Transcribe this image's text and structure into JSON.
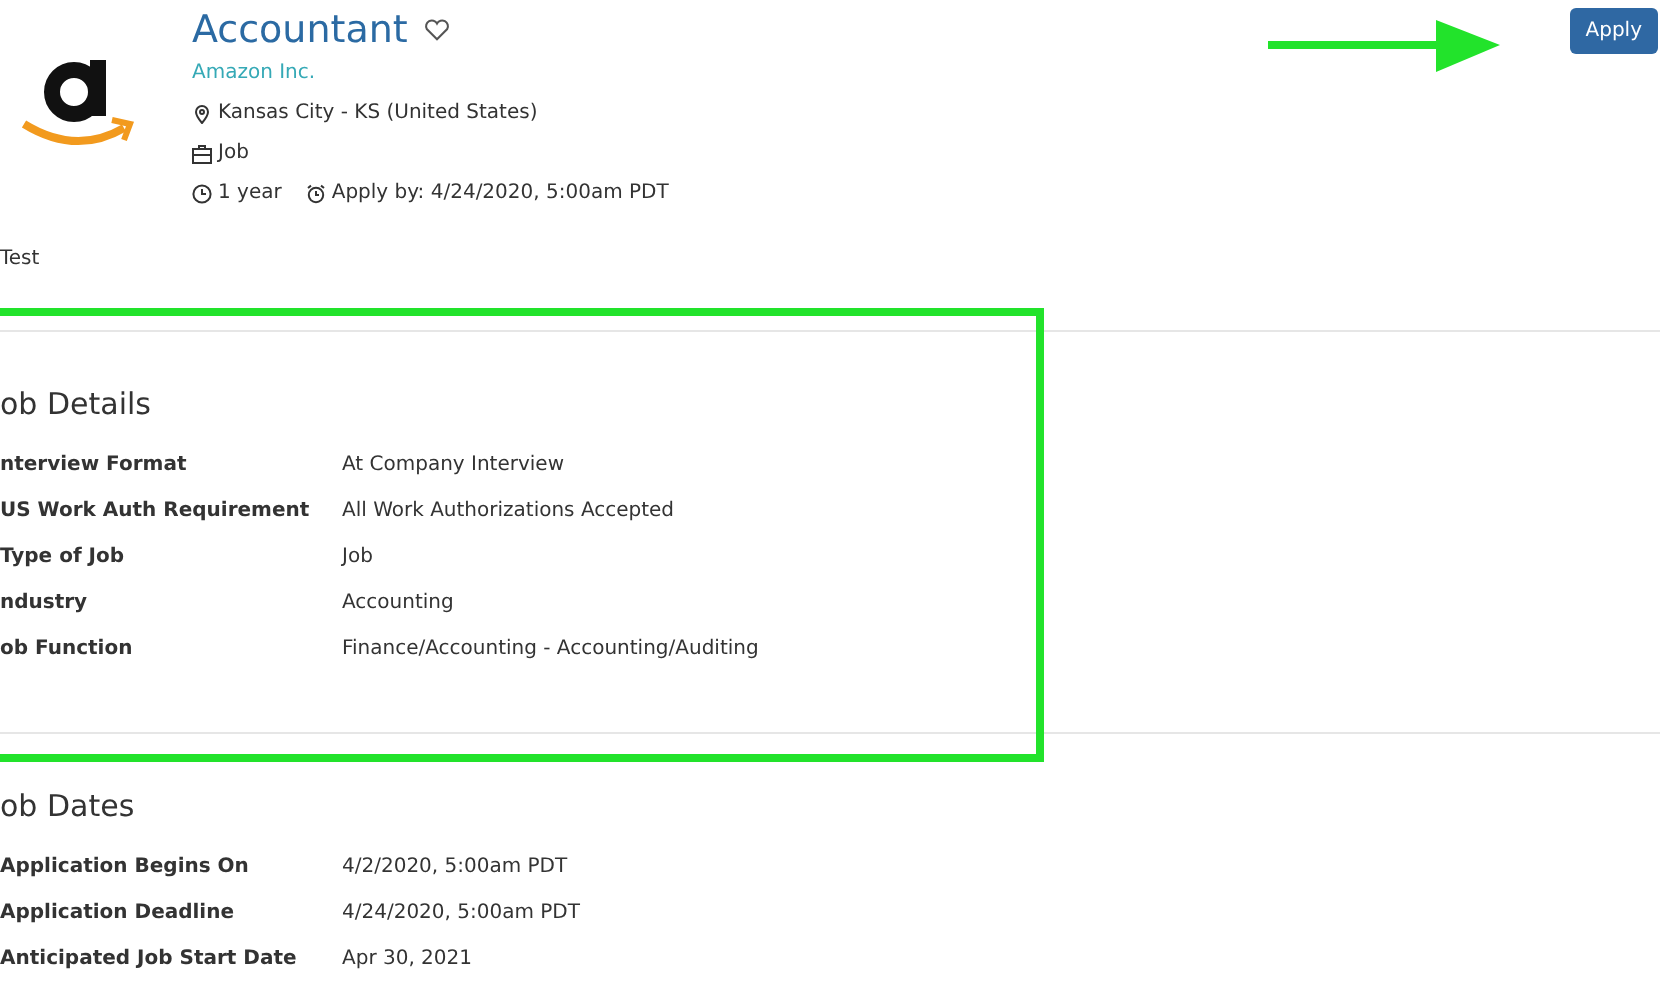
{
  "header": {
    "title": "Accountant",
    "company": "Amazon Inc.",
    "location": "Kansas City - KS (United States)",
    "job_type": "Job",
    "duration": "1 year",
    "apply_by": "Apply by: 4/24/2020, 5:00am PDT",
    "favorite": false
  },
  "apply_button": "Apply",
  "description": "Test",
  "sections": [
    {
      "title": "ob Details",
      "rows": [
        {
          "label": "nterview Format",
          "value": "At Company Interview"
        },
        {
          "label": "US Work Auth Requirement",
          "value": "All Work Authorizations Accepted"
        },
        {
          "label": "Type of Job",
          "value": "Job"
        },
        {
          "label": "ndustry",
          "value": "Accounting"
        },
        {
          "label": "ob Function",
          "value": "Finance/Accounting - Accounting/Auditing"
        }
      ]
    },
    {
      "title": "ob Dates",
      "rows": [
        {
          "label": "Application Begins On",
          "value": "4/2/2020, 5:00am PDT"
        },
        {
          "label": "Application Deadline",
          "value": "4/24/2020, 5:00am PDT"
        },
        {
          "label": "Anticipated Job Start Date",
          "value": "Apr 30, 2021"
        }
      ]
    }
  ],
  "annotations": {
    "highlight_box": true,
    "arrow": true
  }
}
